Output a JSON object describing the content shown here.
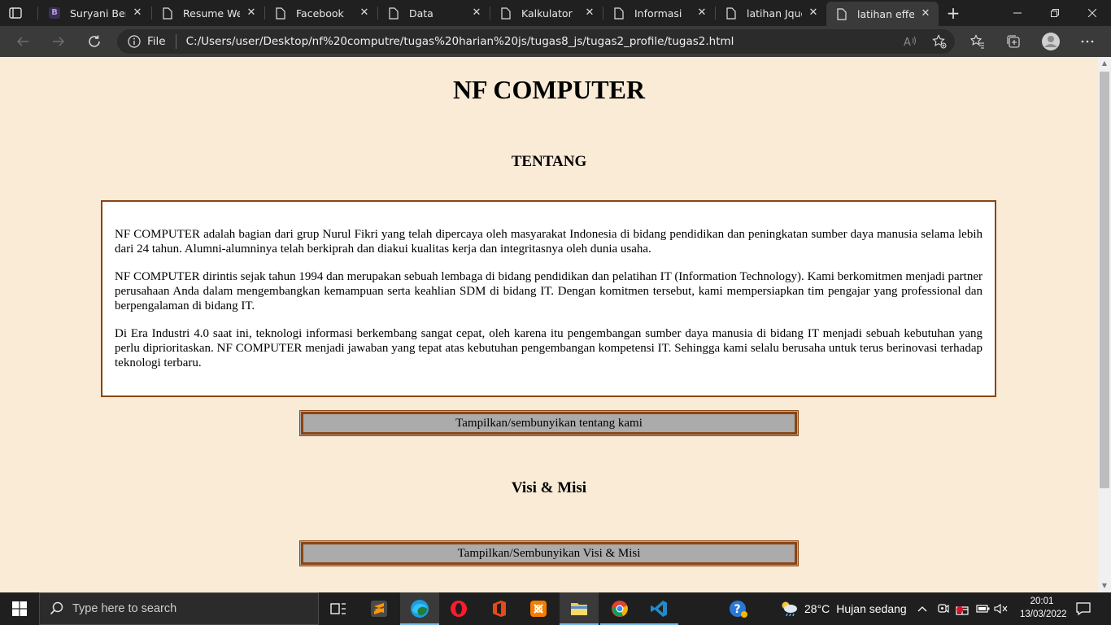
{
  "browser": {
    "tabs": [
      {
        "title": "Suryani Berutu",
        "icon": "badge-b-icon"
      },
      {
        "title": "Resume Website",
        "icon": "page-icon"
      },
      {
        "title": "Facebook",
        "icon": "page-icon"
      },
      {
        "title": "Data",
        "icon": "page-icon"
      },
      {
        "title": "Kalkulator",
        "icon": "page-icon"
      },
      {
        "title": "Informasi",
        "icon": "page-icon"
      },
      {
        "title": "latihan Jquery",
        "icon": "page-icon"
      },
      {
        "title": "latihan effect",
        "icon": "page-icon",
        "active": true
      }
    ],
    "close_glyph": "✕",
    "new_tab_glyph": "+",
    "address": {
      "scheme_label": "File",
      "url": "C:/Users/user/Desktop/nf%20computre/tugas%20harian%20js/tugas8_js/tugas2_profile/tugas2.html"
    }
  },
  "page": {
    "title": "NF COMPUTER",
    "about": {
      "heading": "TENTANG",
      "paragraphs": [
        "NF COMPUTER adalah bagian dari grup Nurul Fikri yang telah dipercaya oleh masyarakat Indonesia di bidang pendidikan dan peningkatan sumber daya manusia selama lebih dari 24 tahun. Alumni-alumninya telah berkiprah dan diakui kualitas kerja dan integritasnya oleh dunia usaha.",
        "NF COMPUTER dirintis sejak tahun 1994 dan merupakan sebuah lembaga di bidang pendidikan dan pelatihan IT (Information Technology). Kami berkomitmen menjadi partner perusahaan Anda dalam mengembangkan kemampuan serta keahlian SDM di bidang IT. Dengan komitmen tersebut, kami mempersiapkan tim pengajar yang professional dan berpengalaman di bidang IT.",
        "Di Era Industri 4.0 saat ini, teknologi informasi berkembang sangat cepat, oleh karena itu pengembangan sumber daya manusia di bidang IT menjadi sebuah kebutuhan yang perlu diprioritaskan. NF COMPUTER menjadi jawaban yang tepat atas kebutuhan pengembangan kompetensi IT. Sehingga kami selalu berusaha untuk terus berinovasi terhadap teknologi terbaru."
      ],
      "toggle_label": "Tampilkan/sembunyikan tentang kami"
    },
    "visi_misi": {
      "heading": "Visi & Misi",
      "toggle_label": "Tampilkan/Sembunyikan Visi & Misi"
    }
  },
  "taskbar": {
    "search_placeholder": "Type here to search",
    "weather": {
      "temperature": "28°C",
      "condition": "Hujan sedang"
    },
    "clock": {
      "time": "20:01",
      "date": "13/03/2022"
    },
    "apps": [
      "task-view-icon",
      "sublime-text-icon",
      "edge-icon",
      "opera-icon",
      "office-icon",
      "xampp-icon",
      "file-explorer-icon",
      "chrome-icon",
      "vscode-icon"
    ]
  },
  "colors": {
    "page_background": "#faebd7",
    "box_border": "#8b4513",
    "button_background": "#ababab"
  }
}
